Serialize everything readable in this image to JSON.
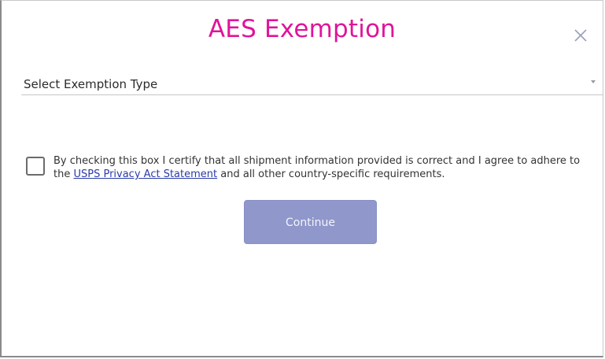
{
  "dialog": {
    "title": "AES Exemption",
    "close_icon": "close-icon"
  },
  "exemption_select": {
    "label": "Select Exemption Type",
    "arrow_icon": "chevron-down-icon"
  },
  "certification": {
    "checked": false,
    "text_before": "By checking this box I certify that all shipment information provided is correct and I agree to adhere to the ",
    "link_text": "USPS Privacy Act Statement",
    "text_after": " and all other country-specific requirements."
  },
  "actions": {
    "continue_label": "Continue"
  },
  "colors": {
    "title": "#e0149a",
    "link": "#2a3aa8",
    "continue_bg": "#8f97cb"
  }
}
